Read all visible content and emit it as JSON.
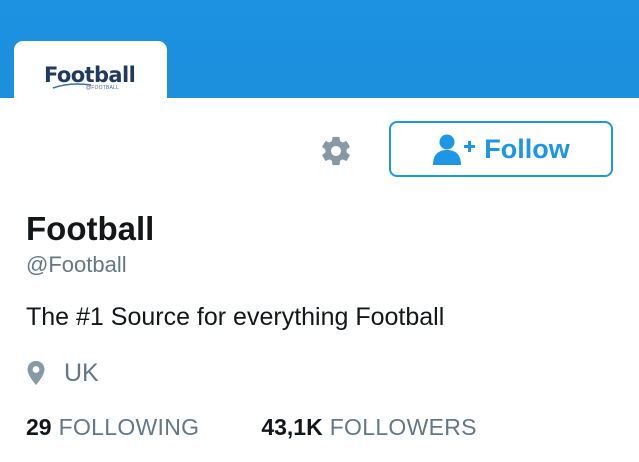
{
  "header": {
    "banner_color": "#1d8fdc"
  },
  "avatar": {
    "logo_text": "Football",
    "logo_subtext": "@FOOTBALL"
  },
  "actions": {
    "settings_icon": "gear-icon",
    "follow_icon": "add-user-icon",
    "follow_label": "Follow",
    "accent_color": "#1d96e6"
  },
  "profile": {
    "name": "Football",
    "handle": "@Football",
    "bio": "The #1 Source for everything Football",
    "location_icon": "map-pin-icon",
    "location": "UK"
  },
  "stats": [
    {
      "value": "29",
      "label": "FOLLOWING"
    },
    {
      "value": "43,1K",
      "label": "FOLLOWERS"
    }
  ]
}
